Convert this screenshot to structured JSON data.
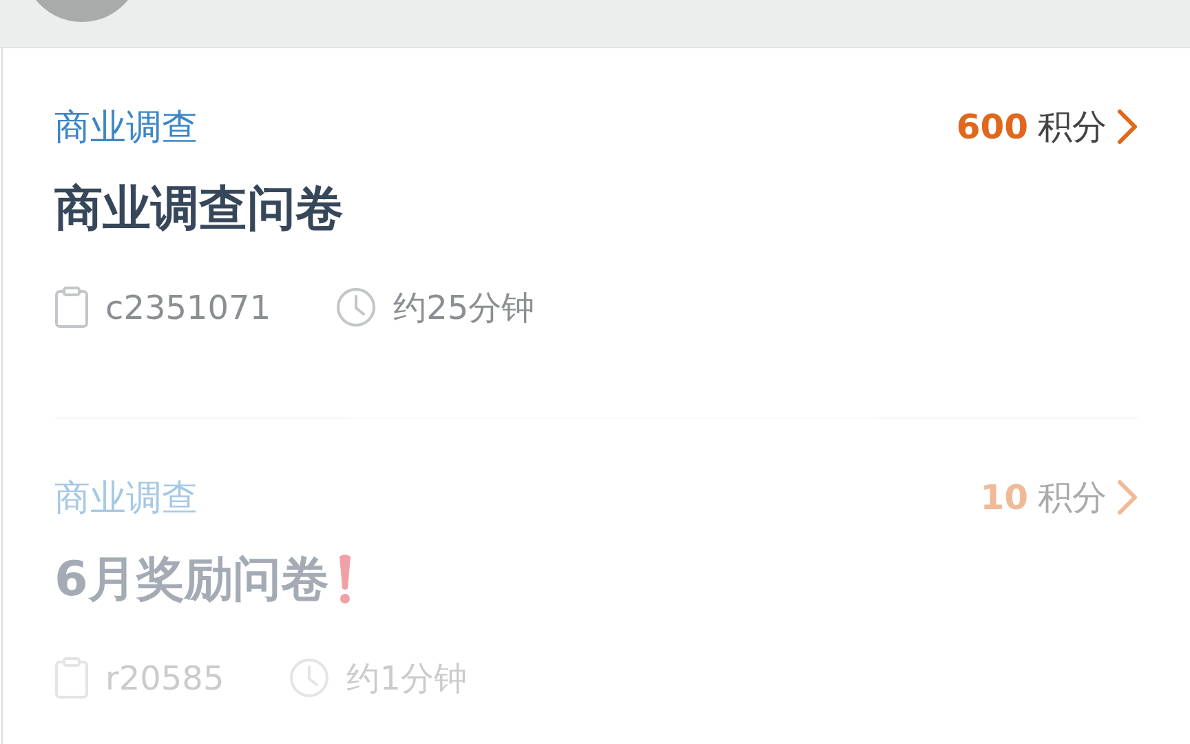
{
  "surveys": [
    {
      "category": "商业调查",
      "points": "600",
      "points_unit": "积分",
      "title": "商业调查问卷",
      "alert": false,
      "disabled": false,
      "code": "c2351071",
      "duration": "约25分钟"
    },
    {
      "category": "商业调查",
      "points": "10",
      "points_unit": "积分",
      "title": "6月奖励问卷",
      "alert": true,
      "disabled": true,
      "code": "r20585",
      "duration": "约1分钟"
    }
  ]
}
